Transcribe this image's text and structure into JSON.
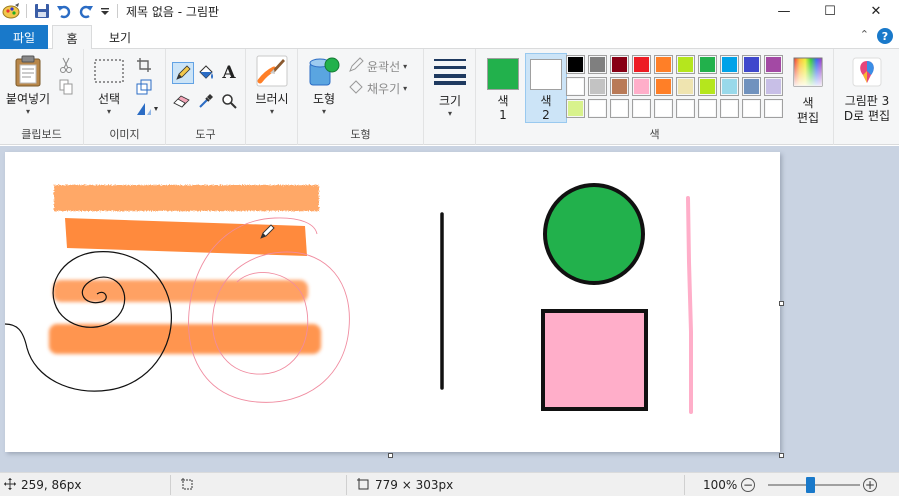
{
  "window": {
    "title": "제목 없음 - 그림판",
    "minimize_glyph": "—",
    "maximize_glyph": "☐",
    "close_glyph": "✕"
  },
  "tabs": {
    "file": "파일",
    "home": "홈",
    "view": "보기",
    "help_glyph": "?",
    "collapse_glyph": "⌃"
  },
  "ribbon": {
    "clipboard": {
      "paste_label": "붙여넣기",
      "group_label": "클립보드"
    },
    "image": {
      "select_label": "선택",
      "group_label": "이미지"
    },
    "tools": {
      "group_label": "도구",
      "text_glyph": "A"
    },
    "brushes": {
      "label": "브러시"
    },
    "shapes": {
      "shape_label": "도형",
      "outline_label": "윤곽선",
      "fill_label": "채우기",
      "group_label": "도형"
    },
    "size": {
      "label": "크기"
    },
    "colors": {
      "color1_label": "색\n1",
      "color1_line1": "색",
      "color1_line2": "1",
      "color2_line1": "색",
      "color2_line2": "2",
      "edit_colors_line1": "색",
      "edit_colors_line2": "편집",
      "group_label": "색",
      "color1_value": "#22b14c",
      "color2_value": "#ffffff",
      "palette": [
        "#000000",
        "#7f7f7f",
        "#880015",
        "#ed1c24",
        "#ff7f27",
        "#b5e61d",
        "#22b14c",
        "#00a2e8",
        "#3f48cc",
        "#a349a4",
        "#ffffff",
        "#c3c3c3",
        "#b97a57",
        "#ffaec9",
        "#ff7f27",
        "#efe4b0",
        "#b5e61d",
        "#99d9ea",
        "#7092be",
        "#c8bfe7",
        "#d8f28c",
        "#ffffff",
        "#ffffff",
        "#ffffff",
        "#ffffff",
        "#ffffff",
        "#ffffff",
        "#ffffff",
        "#ffffff",
        "#ffffff"
      ]
    },
    "paint3d": {
      "line1": "그림판 3",
      "line2": "D로 편집"
    }
  },
  "canvas": {
    "background": "#ffffff",
    "shapes": {
      "circle_fill": "#22b14c",
      "rect_fill": "#ffaec9",
      "brush_orange": "#ff7f27",
      "pink_line": "#ffaec9"
    }
  },
  "status": {
    "cursor_pos": "259, 86px",
    "canvas_size": "779 × 303px",
    "zoom": "100%"
  }
}
